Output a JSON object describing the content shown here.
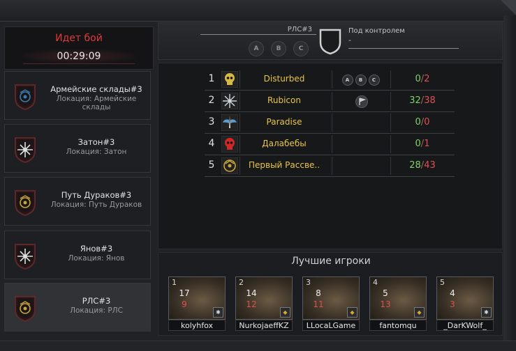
{
  "battle": {
    "title": "Идет бой",
    "timer": "00:29:09"
  },
  "locations": [
    {
      "name": "Армейские склады#3",
      "sub": "Локация: Армейские склады",
      "emblem": "blue-crest-icon",
      "color": "#3a7bb0"
    },
    {
      "name": "Затон#3",
      "sub": "Локация: Затон",
      "emblem": "white-star-icon",
      "color": "#dddddd"
    },
    {
      "name": "Путь Дураков#3",
      "sub": "Локация: Путь Дураков",
      "emblem": "gold-crest-icon",
      "color": "#c9a53a"
    },
    {
      "name": "Янов#3",
      "sub": "Локация: Янов",
      "emblem": "white-star-icon",
      "color": "#dddddd"
    },
    {
      "name": "РЛС#3",
      "sub": "Локация: РЛС",
      "emblem": "gold-crest-icon",
      "color": "#c9a53a"
    }
  ],
  "header": {
    "location_name": "РЛС#3",
    "points": [
      "A",
      "B",
      "C"
    ],
    "control_label": "Под контролем",
    "control_value": "-"
  },
  "clans": [
    {
      "rank": "1",
      "name": "Disturbed",
      "emblem": "skull-icon",
      "color": "#d6b845",
      "has_points": true,
      "has_flag": false,
      "captured": "0",
      "total": "2"
    },
    {
      "rank": "2",
      "name": "Rubicon",
      "emblem": "compass-star-icon",
      "color": "#cfd6de",
      "has_points": false,
      "has_flag": true,
      "captured": "32",
      "total": "38"
    },
    {
      "rank": "3",
      "name": "Paradise",
      "emblem": "winged-sword-icon",
      "color": "#5a9bd0",
      "has_points": false,
      "has_flag": false,
      "captured": "0",
      "total": "0"
    },
    {
      "rank": "4",
      "name": "Далабебы",
      "emblem": "red-skull-icon",
      "color": "#d02828",
      "has_points": false,
      "has_flag": false,
      "captured": "0",
      "total": "1"
    },
    {
      "rank": "5",
      "name": "Первый Рассве..",
      "emblem": "gold-emblem-icon",
      "color": "#c9a53a",
      "has_points": false,
      "has_flag": false,
      "captured": "28",
      "total": "43"
    }
  ],
  "best_players": {
    "title": "Лучшие игроки",
    "players": [
      {
        "rank": "1",
        "kills": "17",
        "deaths": "9",
        "name": "kolyhfox",
        "badge": "star-badge-icon"
      },
      {
        "rank": "2",
        "kills": "14",
        "deaths": "12",
        "name": "NurkojaeffKZ",
        "badge": "gold-badge-icon"
      },
      {
        "rank": "3",
        "kills": "8",
        "deaths": "11",
        "name": "LLocaLGame",
        "badge": "gold-badge-icon"
      },
      {
        "rank": "4",
        "kills": "5",
        "deaths": "13",
        "name": "fantomqu",
        "badge": "gold-badge-icon"
      },
      {
        "rank": "5",
        "kills": "4",
        "deaths": "3",
        "name": "_DarKWolf_",
        "badge": "star-badge-icon"
      }
    ]
  }
}
